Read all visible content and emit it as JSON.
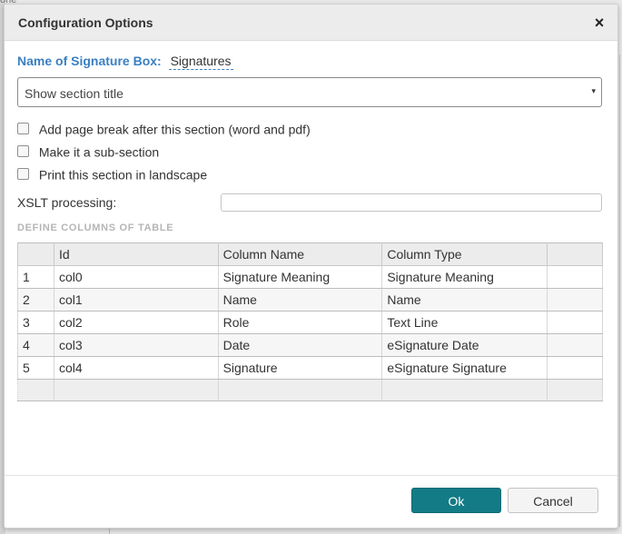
{
  "backdrop": {
    "fragment_text": "one"
  },
  "dialog": {
    "title": "Configuration Options",
    "close_glyph": "×"
  },
  "name_field": {
    "label": "Name of Signature Box:",
    "value": "Signatures"
  },
  "section_title_select": {
    "selected": "Show section title",
    "caret": "▾"
  },
  "options": [
    {
      "label": "Add page break after this section (word and pdf)",
      "checked": false
    },
    {
      "label": "Make it a sub-section",
      "checked": false
    },
    {
      "label": "Print this section in landscape",
      "checked": false
    }
  ],
  "xslt": {
    "label": "XSLT processing:",
    "value": ""
  },
  "columns_section": {
    "heading": "DEFINE COLUMNS OF TABLE",
    "headers": [
      "",
      "Id",
      "Column Name",
      "Column Type",
      ""
    ],
    "rows": [
      {
        "num": "1",
        "id": "col0",
        "name": "Signature Meaning",
        "type": "Signature Meaning"
      },
      {
        "num": "2",
        "id": "col1",
        "name": "Name",
        "type": "Name"
      },
      {
        "num": "3",
        "id": "col2",
        "name": "Role",
        "type": "Text Line"
      },
      {
        "num": "4",
        "id": "col3",
        "name": "Date",
        "type": "eSignature Date"
      },
      {
        "num": "5",
        "id": "col4",
        "name": "Signature",
        "type": "eSignature Signature"
      }
    ]
  },
  "footer": {
    "ok_label": "Ok",
    "cancel_label": "Cancel"
  },
  "colors": {
    "accent_blue": "#3a7fc2",
    "ok_button": "#127b86",
    "section_heading": "#b5b5b5"
  }
}
